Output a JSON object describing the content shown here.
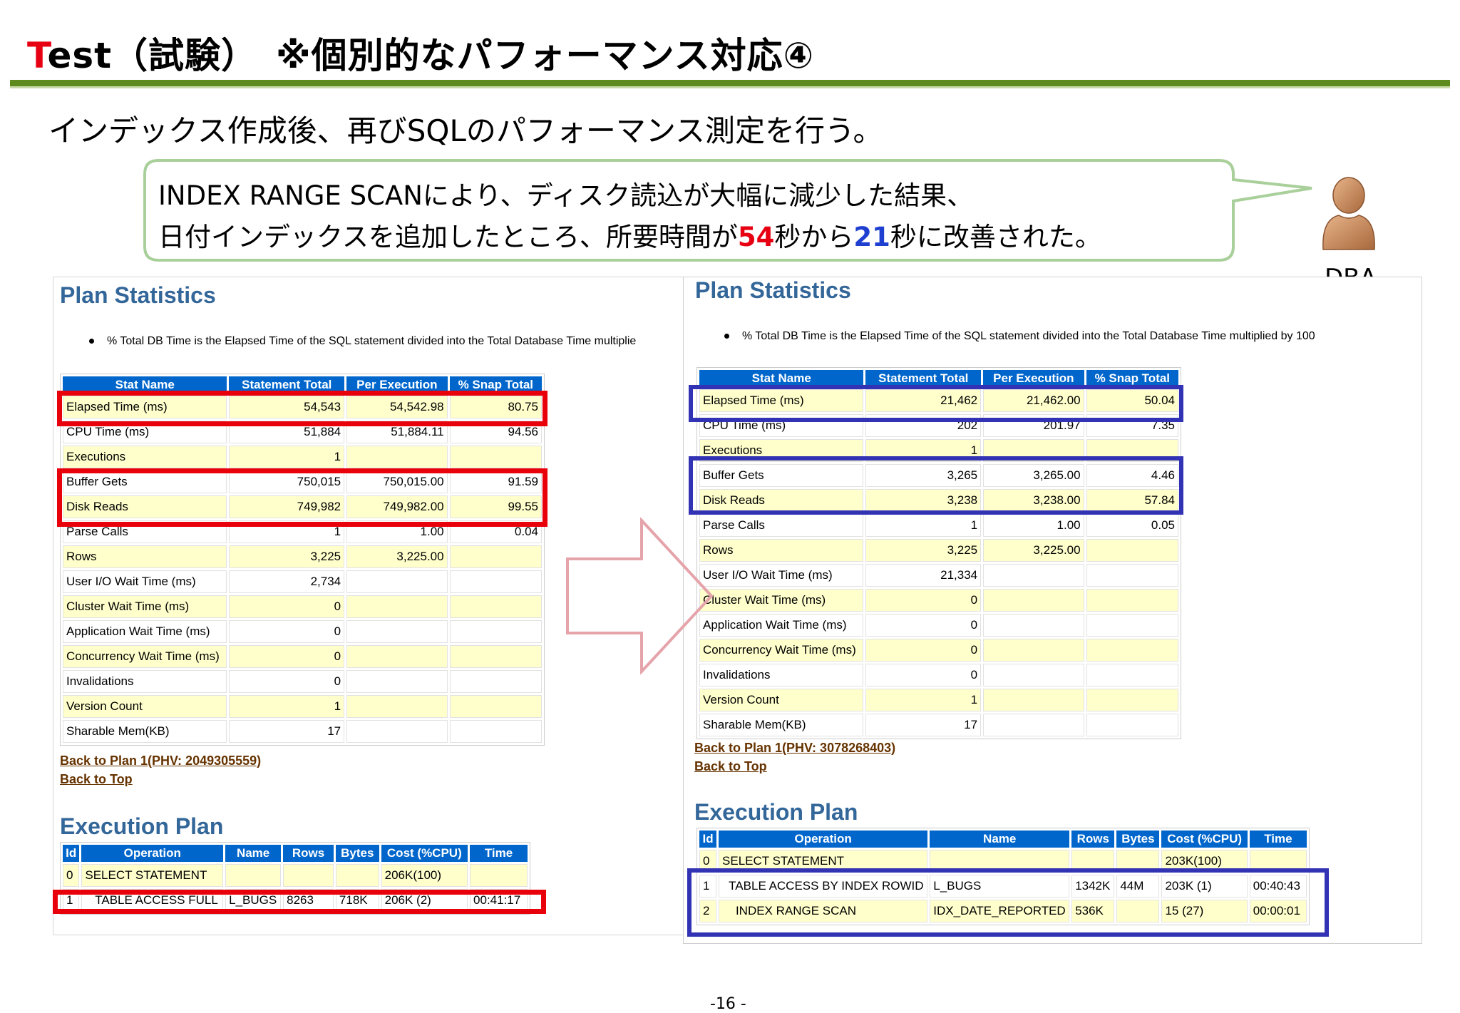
{
  "slide": {
    "title_first": "T",
    "title_rest": "est（試験）　※個別的なパフォーマンス対応④",
    "subtitle": "インデックス作成後、再びSQLのパフォーマンス測定を行う。",
    "callout_line1": "INDEX RANGE SCANにより、ディスク読込が大幅に減少した結果、",
    "callout_line2_a": "日付インデックスを追加したところ、所要時間が",
    "callout_num_before": "54",
    "callout_line2_b": "秒から",
    "callout_num_after": "21",
    "callout_line2_c": "秒に改善された。",
    "dba_label": "DBA",
    "page_number": "-16 -",
    "colors": {
      "title_accent": "#e60012",
      "rule": "#5f8a1d",
      "before_highlight": "#e8000b",
      "after_highlight": "#3232b4",
      "report_heading": "#336699",
      "table_header": "#0066cc",
      "row_fill": "#ffffcc"
    },
    "icons": [
      "person-icon",
      "right-arrow-icon"
    ]
  },
  "before": {
    "plan_heading": "Plan Statistics",
    "note": "% Total DB Time is the Elapsed Time of the SQL statement divided into the Total Database Time multiplie",
    "columns": [
      "Stat Name",
      "Statement Total",
      "Per Execution",
      "% Snap Total"
    ],
    "rows": [
      [
        "Elapsed Time (ms)",
        "54,543",
        "54,542.98",
        "80.75"
      ],
      [
        "CPU Time (ms)",
        "51,884",
        "51,884.11",
        "94.56"
      ],
      [
        "Executions",
        "1",
        "",
        ""
      ],
      [
        "Buffer Gets",
        "750,015",
        "750,015.00",
        "91.59"
      ],
      [
        "Disk Reads",
        "749,982",
        "749,982.00",
        "99.55"
      ],
      [
        "Parse Calls",
        "1",
        "1.00",
        "0.04"
      ],
      [
        "Rows",
        "3,225",
        "3,225.00",
        ""
      ],
      [
        "User I/O Wait Time (ms)",
        "2,734",
        "",
        ""
      ],
      [
        "Cluster Wait Time (ms)",
        "0",
        "",
        ""
      ],
      [
        "Application Wait Time (ms)",
        "0",
        "",
        ""
      ],
      [
        "Concurrency Wait Time (ms)",
        "0",
        "",
        ""
      ],
      [
        "Invalidations",
        "0",
        "",
        ""
      ],
      [
        "Version Count",
        "1",
        "",
        ""
      ],
      [
        "Sharable Mem(KB)",
        "17",
        "",
        ""
      ]
    ],
    "back_to_plan": "Back to Plan 1(PHV: 2049305559)",
    "back_to_top": "Back to Top",
    "exec_heading": "Execution Plan",
    "exec_columns": [
      "Id",
      "Operation",
      "Name",
      "Rows",
      "Bytes",
      "Cost (%CPU)",
      "Time"
    ],
    "exec_rows": [
      [
        "0",
        "SELECT STATEMENT",
        "",
        "",
        "",
        "206K(100)",
        ""
      ],
      [
        "1",
        "   TABLE ACCESS FULL",
        "L_BUGS",
        "8263",
        "718K",
        "206K (2)",
        "00:41:17"
      ]
    ]
  },
  "after": {
    "plan_heading": "Plan Statistics",
    "note": "% Total DB Time is the Elapsed Time of the SQL statement divided into the Total Database Time multiplied by 100",
    "columns": [
      "Stat Name",
      "Statement Total",
      "Per Execution",
      "% Snap Total"
    ],
    "rows": [
      [
        "Elapsed Time (ms)",
        "21,462",
        "21,462.00",
        "50.04"
      ],
      [
        "CPU Time (ms)",
        "202",
        "201.97",
        "7.35"
      ],
      [
        "Executions",
        "1",
        "",
        ""
      ],
      [
        "Buffer Gets",
        "3,265",
        "3,265.00",
        "4.46"
      ],
      [
        "Disk Reads",
        "3,238",
        "3,238.00",
        "57.84"
      ],
      [
        "Parse Calls",
        "1",
        "1.00",
        "0.05"
      ],
      [
        "Rows",
        "3,225",
        "3,225.00",
        ""
      ],
      [
        "User I/O Wait Time (ms)",
        "21,334",
        "",
        ""
      ],
      [
        "Cluster Wait Time (ms)",
        "0",
        "",
        ""
      ],
      [
        "Application Wait Time (ms)",
        "0",
        "",
        ""
      ],
      [
        "Concurrency Wait Time (ms)",
        "0",
        "",
        ""
      ],
      [
        "Invalidations",
        "0",
        "",
        ""
      ],
      [
        "Version Count",
        "1",
        "",
        ""
      ],
      [
        "Sharable Mem(KB)",
        "17",
        "",
        ""
      ]
    ],
    "back_to_plan": "Back to Plan 1(PHV: 3078268403)",
    "back_to_top": "Back to Top",
    "exec_heading": "Execution Plan",
    "exec_columns": [
      "Id",
      "Operation",
      "Name",
      "Rows",
      "Bytes",
      "Cost (%CPU)",
      "Time"
    ],
    "exec_rows": [
      [
        "0",
        "SELECT STATEMENT",
        "",
        "",
        "",
        "203K(100)",
        ""
      ],
      [
        "1",
        "  TABLE ACCESS BY INDEX ROWID",
        "L_BUGS",
        "1342K",
        "44M",
        "203K (1)",
        "00:40:43"
      ],
      [
        "2",
        "    INDEX RANGE SCAN",
        "IDX_DATE_REPORTED",
        "536K",
        "",
        "15 (27)",
        "00:00:01"
      ]
    ]
  }
}
